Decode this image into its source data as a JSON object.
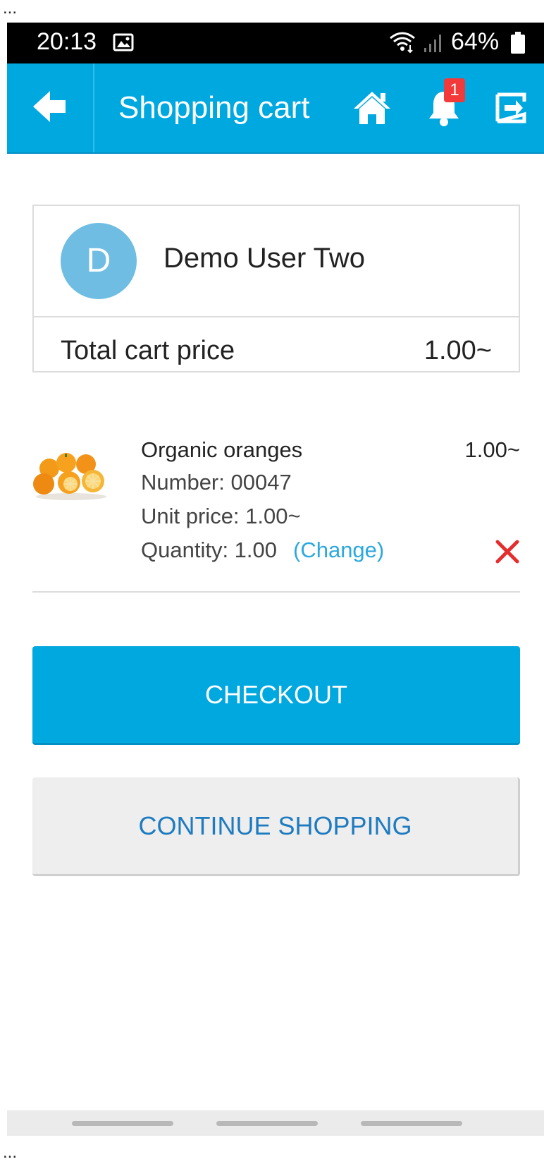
{
  "status_bar": {
    "time": "20:13",
    "battery": "64%",
    "icons": [
      "image-icon",
      "wifi-icon",
      "signal-icon",
      "battery-icon"
    ]
  },
  "app_bar": {
    "title": "Shopping cart",
    "notification_count": "1",
    "color": "#00a8e0",
    "icons": [
      "back-arrow-icon",
      "home-icon",
      "bell-icon",
      "logout-icon"
    ]
  },
  "user": {
    "initial": "D",
    "name": "Demo User Two",
    "avatar_color": "#6fbde2"
  },
  "cart": {
    "total_label": "Total cart price",
    "total_value": "1.00~"
  },
  "items": [
    {
      "name": "Organic oranges",
      "price": "1.00~",
      "number": "Number: 00047",
      "unit_price": "Unit price: 1.00~",
      "quantity": "Quantity: 1.00",
      "change_label": "(Change)",
      "image": "oranges-image",
      "remove_icon": "close-x-icon"
    }
  ],
  "actions": {
    "checkout": "CHECKOUT",
    "continue": "CONTINUE SHOPPING"
  },
  "overflow_marks": {
    "top": "...",
    "bottom": "..."
  }
}
